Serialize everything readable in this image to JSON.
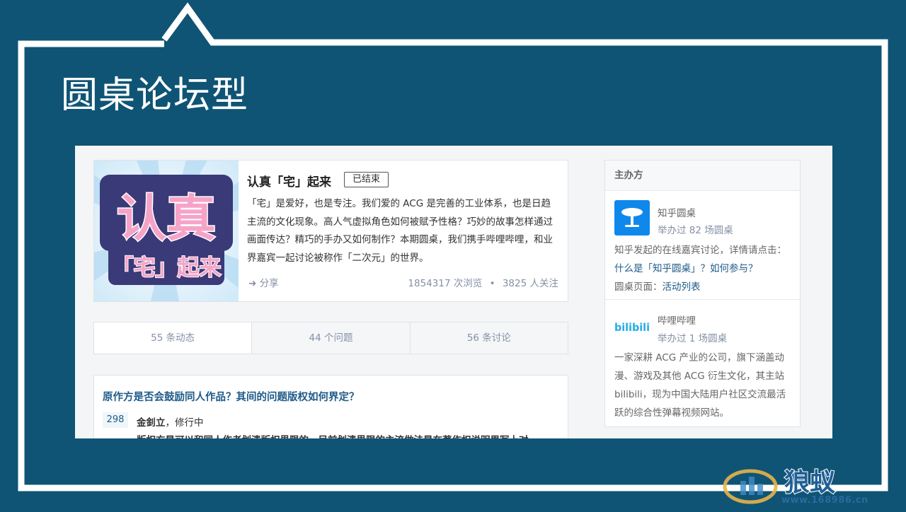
{
  "slide": {
    "title": "圆桌论坛型"
  },
  "roundtable": {
    "cover": {
      "line1": "认真",
      "line2": "「宅」起来"
    },
    "title": "认真「宅」起来",
    "status_badge": "已结束",
    "description": "「宅」是爱好，也是专注。我们爱的 ACG 是完善的工业体系，也是日趋主流的文化现象。高人气虚拟角色如何被赋予性格？巧妙的故事怎样通过画面传达？精巧的手办又如何制作？本期圆桌，我们携手哔哩哔哩，和业界嘉宾一起讨论被称作「二次元」的世界。",
    "share_label": "分享",
    "views": "1854317 次浏览",
    "dot": "•",
    "followers": "3825 人关注"
  },
  "tabs": [
    {
      "label": "55 条动态"
    },
    {
      "label": "44 个问题"
    },
    {
      "label": "56 条讨论"
    }
  ],
  "question": {
    "title": "原作方是否会鼓励同人作品？其间的问题版权如何界定？",
    "votes": "298",
    "author_name": "金釗立",
    "author_bio": "修行中",
    "answer_cut": "版权方是可以和同人作者划清版权界限的，目前划清界限的主流做法是在著作权说明里写上对"
  },
  "sidebar": {
    "heading": "主办方",
    "org1": {
      "name": "知乎圆桌",
      "count": "举办过 82 场圆桌",
      "desc_1": "知乎发起的在线嘉宾讨论，详情请点击：",
      "link_1": "什么是「知乎圆桌」？如何参与？",
      "desc_2": "圆桌页面：",
      "link_2": "活动列表"
    },
    "org2": {
      "logo_text": "bilibili",
      "name": "哔哩哔哩",
      "count": "举办过 1 场圆桌",
      "desc": "一家深耕 ACG 产业的公司，旗下涵盖动漫、游戏及其他 ACG 衍生文化，其主站 bilibili，现为中国大陆用户社区交流最活跃的综合性弹幕视频网站。"
    }
  },
  "watermark": {
    "text": "狼蚁",
    "url": "www.168986.cn"
  },
  "colors": {
    "background": "#0f5474",
    "frame": "#ffffff",
    "link": "#1e5a88",
    "zhihu_blue": "#0f88eb",
    "bili_blue": "#23ade5"
  }
}
